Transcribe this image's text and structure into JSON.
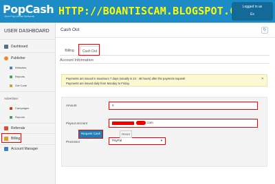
{
  "header": {
    "logo_text": "PopCash",
    "logo_sub": "Your Pop Under Network",
    "watermark": "HTTP://BOANTISCAM.BLOGSPOT.COM",
    "login_line1": "Logged in as",
    "login_line2": "Ex"
  },
  "sidebar": {
    "title": "USER DASHBOARD",
    "dashboard": "Dashboard",
    "publisher": "Publisher",
    "websites": "Websites",
    "reports": "Reports",
    "get_code": "Get Code",
    "advertiser": "Advertiser",
    "campaigns": "Campaigns",
    "adv_reports": "Reports",
    "referrals": "Referrals",
    "billing": "Billing",
    "account_manager": "Account Manager"
  },
  "main": {
    "page_title": "Cash Out",
    "refresh_icon": "↻",
    "tabs": [
      "Billing",
      "Cash Out"
    ],
    "section_title": "Account Information",
    "alert_line1": "Payments are issued in maximum 7 days (usually is 24 - 48 hours) after the payment request!",
    "alert_line2": "Payments are issued daily from Monday to Friday.",
    "alert_close": "✕"
  },
  "form": {
    "amount_label": "Amount",
    "amount_value": "0",
    "payout_label": "Payout account",
    "payout_value": ".com",
    "processor_label": "Processor",
    "processor_value": "PayPal",
    "request_button": "Request Cash Out",
    "reset_button": "Reset"
  },
  "colors": {
    "brand_blue": "#1c8bc6",
    "highlight_red": "#e00000",
    "alert_bg": "#fcf8d2"
  }
}
